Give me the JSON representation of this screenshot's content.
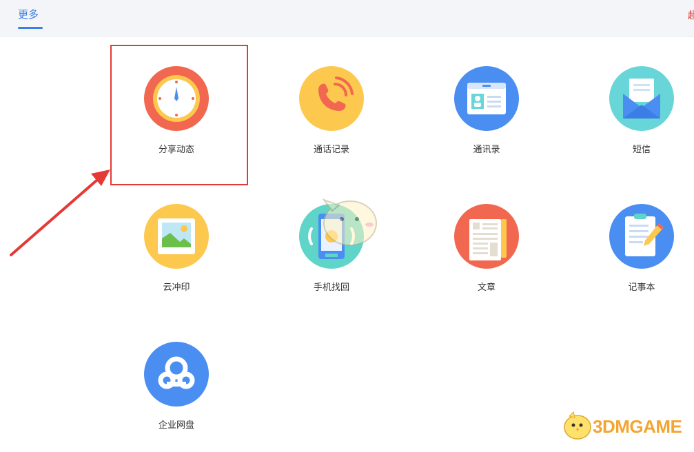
{
  "header": {
    "tab_label": "更多",
    "edge_text": "超"
  },
  "apps": [
    {
      "label": "分享动态",
      "icon": "clock-icon",
      "color": "#f2674f"
    },
    {
      "label": "通话记录",
      "icon": "phone-icon",
      "color": "#fdc84e"
    },
    {
      "label": "通讯录",
      "icon": "contact-card-icon",
      "color": "#4b8ef2"
    },
    {
      "label": "短信",
      "icon": "envelope-icon",
      "color": "#68d6d8"
    },
    {
      "label": "云冲印",
      "icon": "photo-icon",
      "color": "#fdc84e"
    },
    {
      "label": "手机找回",
      "icon": "phone-locate-icon",
      "color": "#5fd4c8"
    },
    {
      "label": "文章",
      "icon": "article-icon",
      "color": "#f2674f"
    },
    {
      "label": "记事本",
      "icon": "notepad-icon",
      "color": "#4b8ef2"
    },
    {
      "label": "企业网盘",
      "icon": "cloud-drive-icon",
      "color": "#4b8ef2"
    }
  ],
  "watermark": {
    "text": "3DMGAME"
  }
}
